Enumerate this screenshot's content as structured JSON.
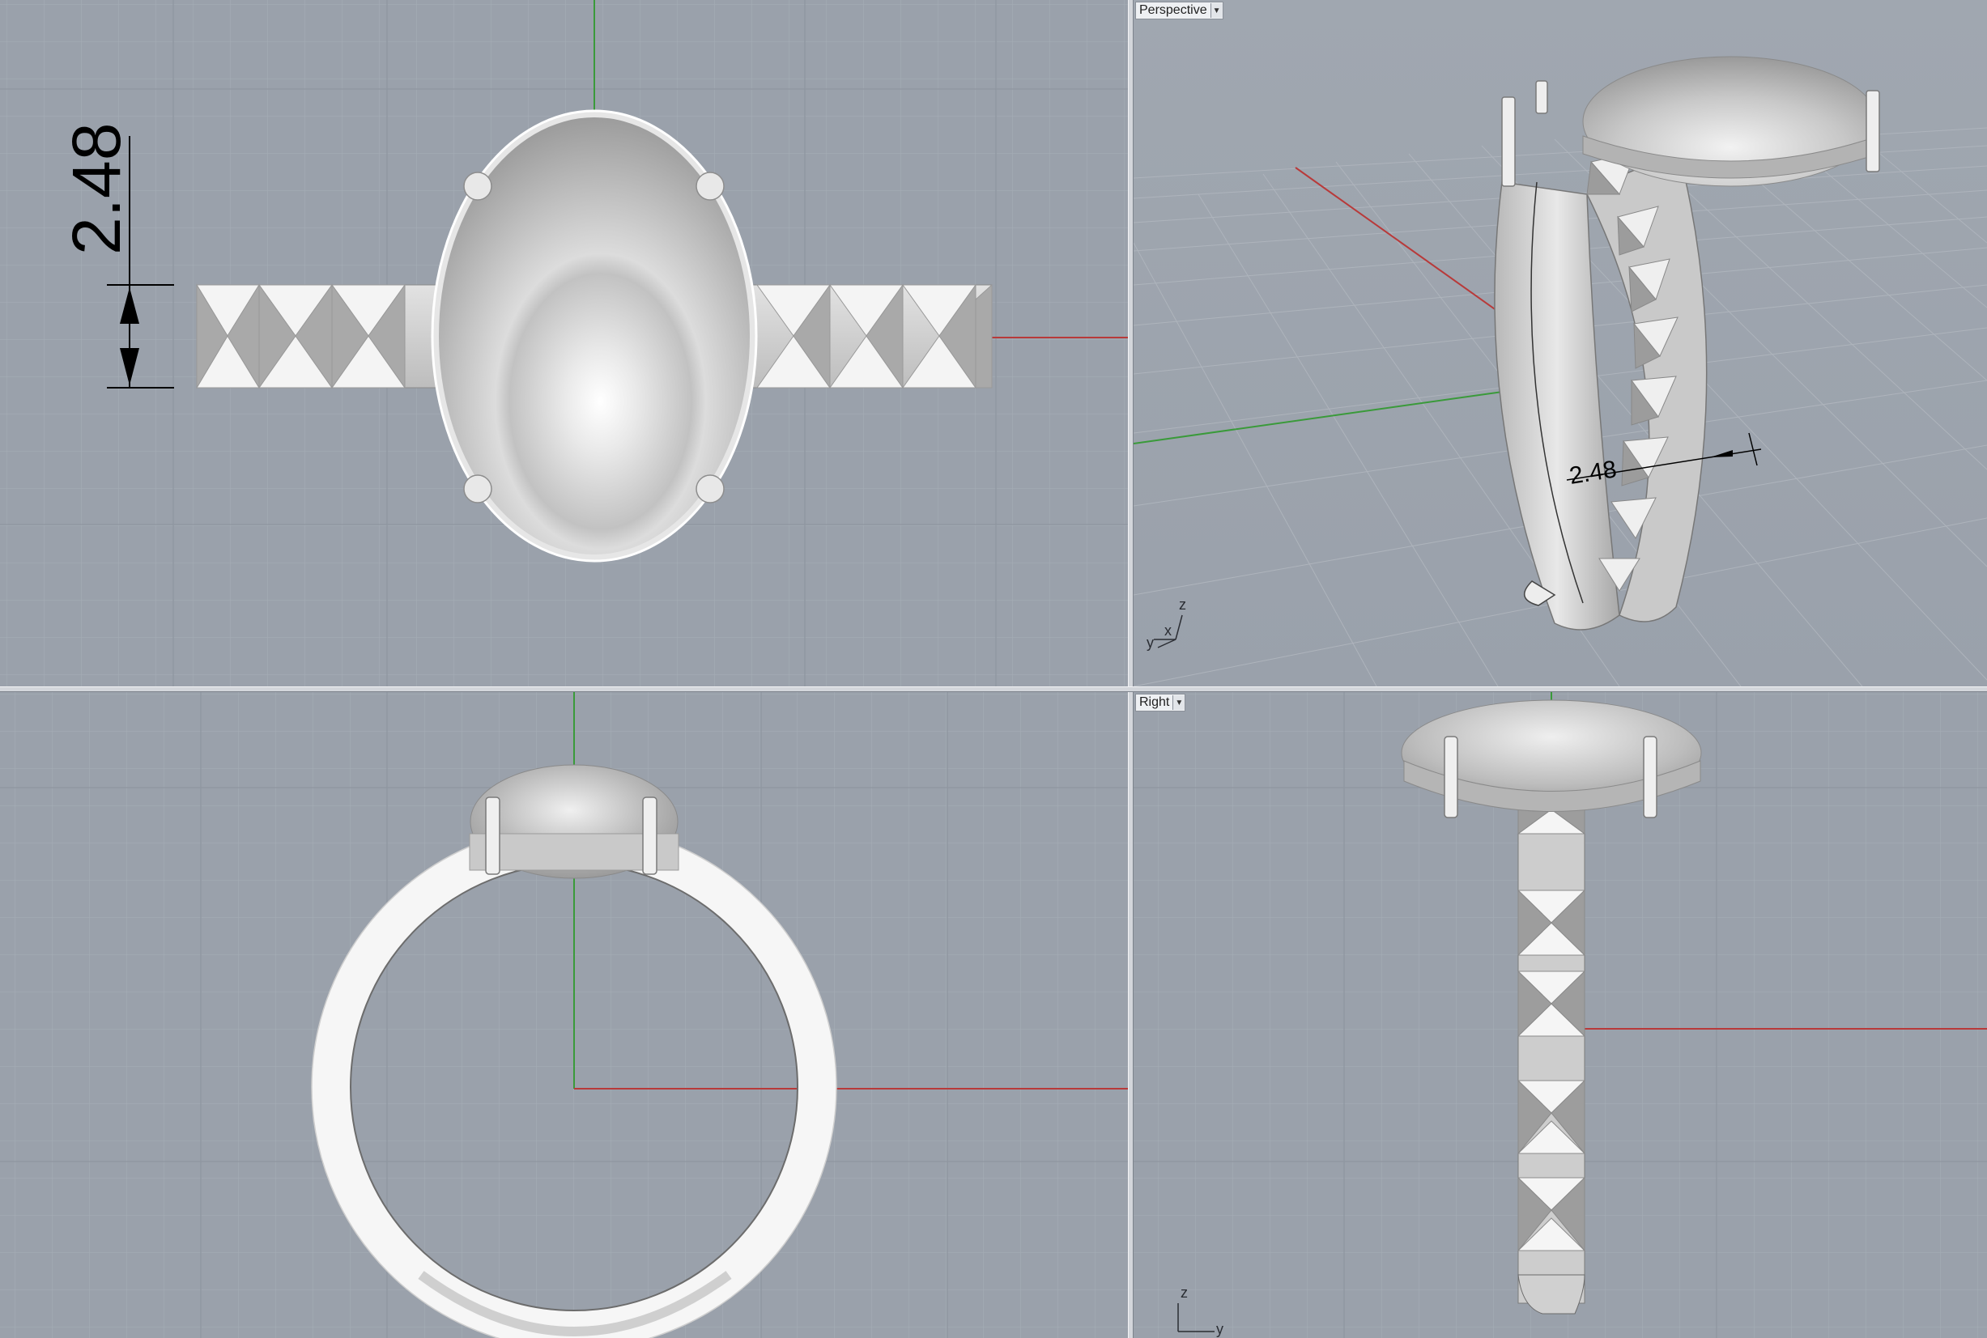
{
  "viewports": {
    "perspective": {
      "label": "Perspective"
    },
    "right": {
      "label": "Right"
    }
  },
  "dimensions": {
    "top_band_width": "2.48",
    "perspective_band_width": "2.48"
  },
  "axis_labels": {
    "perspective": {
      "z": "z",
      "x": "x",
      "y": "y"
    },
    "right": {
      "z": "z",
      "y": "y"
    }
  },
  "icons": {
    "dropdown": "chevron-down-icon"
  },
  "colors": {
    "viewport_bg": "#9aa1ab",
    "grid_minor": "#a6adb6",
    "grid_major": "#8e959f",
    "axis_x": "#b83a3a",
    "axis_y": "#3a9a3a",
    "metal": "#d8d8d8"
  }
}
